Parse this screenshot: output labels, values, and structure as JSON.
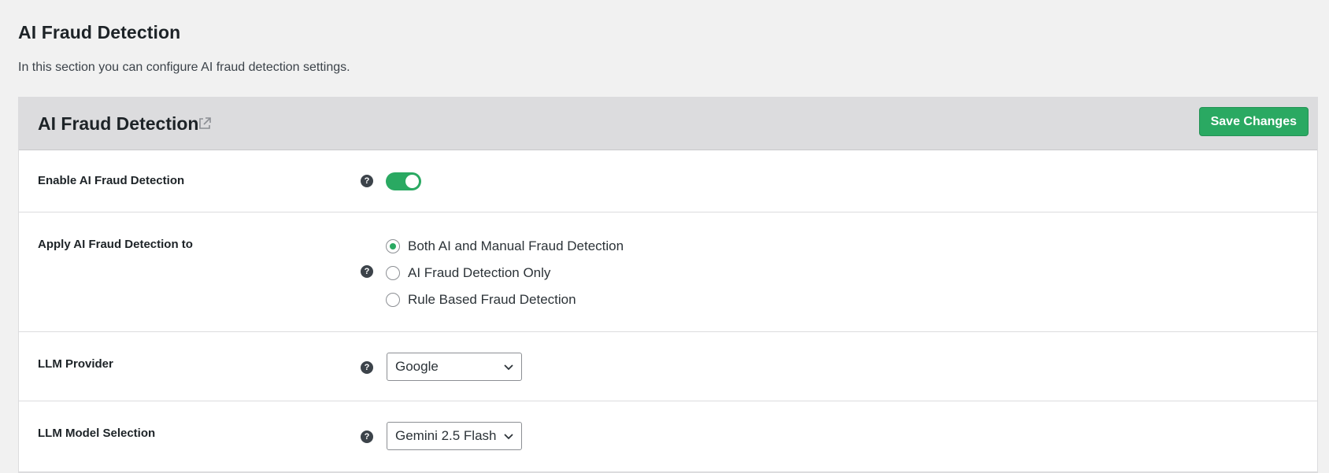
{
  "page": {
    "title": "AI Fraud Detection",
    "description": "In this section you can configure AI fraud detection settings."
  },
  "panel": {
    "title": "AI Fraud Detection",
    "save_label": "Save Changes",
    "external_link_icon": "external-link-icon"
  },
  "settings": {
    "enable": {
      "label": "Enable AI Fraud Detection",
      "enabled": true
    },
    "apply_to": {
      "label": "Apply AI Fraud Detection to",
      "options": [
        {
          "label": "Both AI and Manual Fraud Detection",
          "checked": true
        },
        {
          "label": "AI Fraud Detection Only",
          "checked": false
        },
        {
          "label": "Rule Based Fraud Detection",
          "checked": false
        }
      ]
    },
    "llm_provider": {
      "label": "LLM Provider",
      "value": "Google"
    },
    "llm_model": {
      "label": "LLM Model Selection",
      "value": "Gemini 2.5 Flash"
    }
  },
  "colors": {
    "accent": "#2aa962",
    "header_bg": "#dcdcde",
    "page_bg": "#f1f1f1"
  }
}
